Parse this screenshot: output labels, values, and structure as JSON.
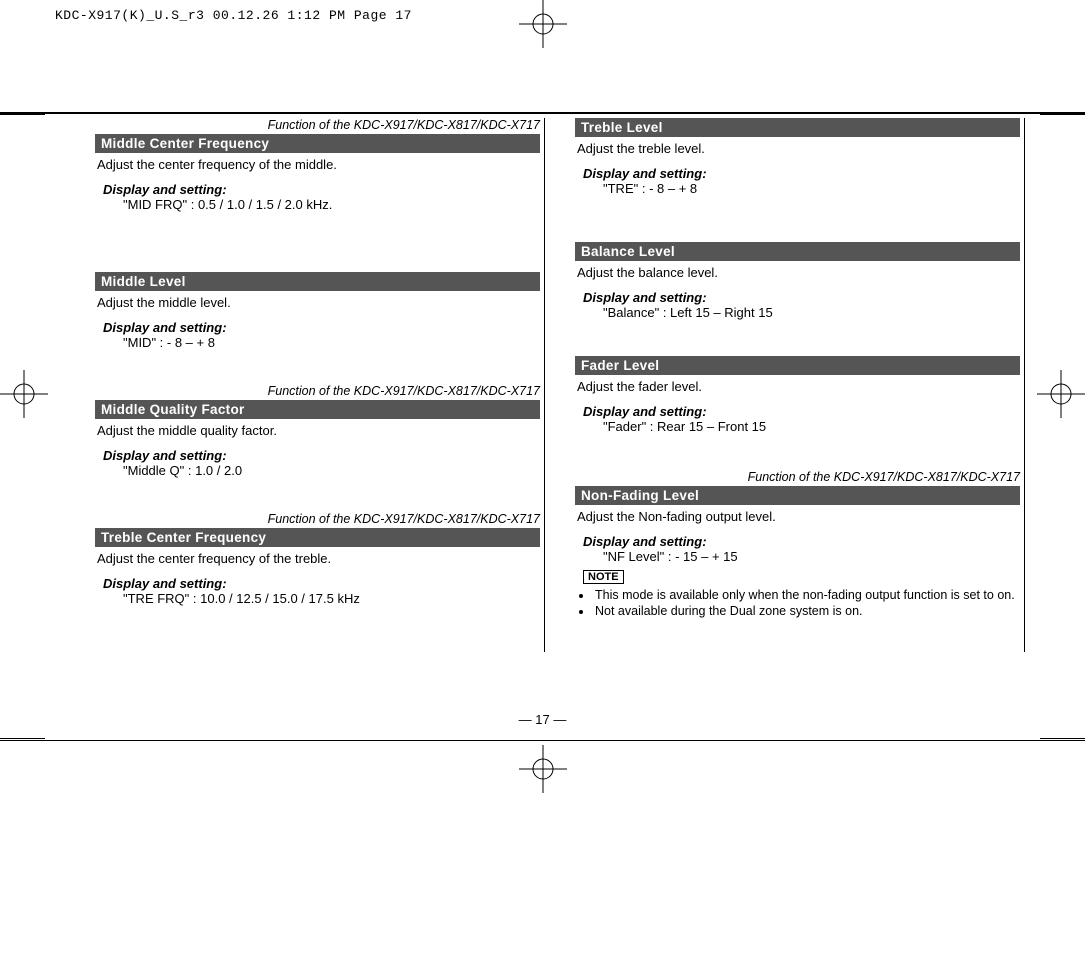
{
  "header": "KDC-X917(K)_U.S_r3  00.12.26 1:12 PM  Page 17",
  "function_note": "Function of the KDC-X917/KDC-X817/KDC-X717",
  "ds_label": "Display and setting:",
  "note_label": "NOTE",
  "page_number": "— 17 —",
  "left": [
    {
      "has_fn": true,
      "title": "Middle Center Frequency",
      "desc": "Adjust the center frequency of the middle.",
      "ds": "\"MID FRQ\" : 0.5 / 1.0 / 1.5 / 2.0 kHz."
    },
    {
      "has_fn": false,
      "title": "Middle Level",
      "desc": "Adjust the middle level.",
      "ds": "\"MID\" : - 8  –  + 8"
    },
    {
      "has_fn": true,
      "title": "Middle Quality Factor",
      "desc": "Adjust the middle quality factor.",
      "ds": "\"Middle Q\" : 1.0 / 2.0"
    },
    {
      "has_fn": true,
      "title": "Treble Center Frequency",
      "desc": "Adjust the center frequency of the treble.",
      "ds": "\"TRE FRQ\" : 10.0 / 12.5 / 15.0 / 17.5 kHz"
    }
  ],
  "right": [
    {
      "has_fn": false,
      "title": "Treble Level",
      "desc": "Adjust the treble level.",
      "ds": "\"TRE\" : - 8  –  + 8"
    },
    {
      "has_fn": false,
      "title": "Balance Level",
      "desc": "Adjust the balance level.",
      "ds": "\"Balance\" : Left 15  –  Right 15"
    },
    {
      "has_fn": false,
      "title": "Fader Level",
      "desc": "Adjust the fader level.",
      "ds": "\"Fader\" : Rear 15  –  Front 15"
    },
    {
      "has_fn": true,
      "title": "Non-Fading Level",
      "desc": "Adjust the Non-fading output level.",
      "ds": "\"NF Level\" : - 15  –  + 15",
      "notes": [
        "This mode is available only when the non-fading output function is set to on.",
        "Not available during the Dual zone system is on."
      ]
    }
  ]
}
